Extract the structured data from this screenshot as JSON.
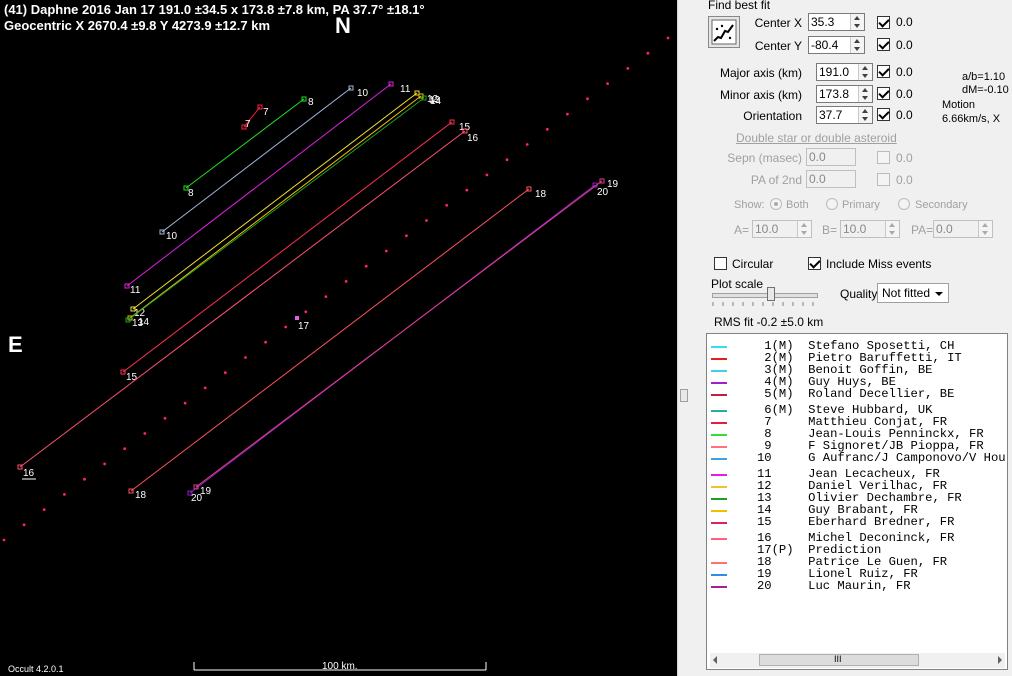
{
  "header": {
    "line1": "(41) Daphne  2016 Jan 17   191.0 ±34.5 x 173.8 ±7.8 km, PA 37.7° ±18.1°",
    "line2": "Geocentric  X  2670.4 ±9.8   Y 4273.9 ±12.7 km"
  },
  "plot": {
    "north_label": "N",
    "east_label": "E",
    "version": "Occult 4.2.0.1",
    "scale_label": "100 km.",
    "chords": [
      {
        "id": "7",
        "color": "#ff2040",
        "label_start": "7",
        "label_end": "7"
      },
      {
        "id": "8",
        "color": "#20e020",
        "label_start": "8",
        "label_end": "8"
      },
      {
        "id": "10",
        "color": "#a0b8d8",
        "label_start": "10",
        "label_end": "10"
      },
      {
        "id": "11",
        "color": "#e020e0",
        "label_start": "11",
        "label_end": "11"
      },
      {
        "id": "12",
        "color": "#f0e030",
        "label_start": "12",
        "label_end": "12"
      },
      {
        "id": "14",
        "color": "#f0c000",
        "label_start": "14",
        "label_end": "14"
      },
      {
        "id": "13",
        "color": "#20a020",
        "label_start": "13",
        "label_end": "13"
      },
      {
        "id": "15",
        "color": "#ff3050",
        "label_start": "15",
        "label_end": "15"
      },
      {
        "id": "16",
        "color": "#ff5070",
        "label_start": "16",
        "label_end": "16"
      },
      {
        "id": "18",
        "color": "#ff5060",
        "label_start": "18",
        "label_end": "18"
      },
      {
        "id": "20",
        "color": "#9020c0",
        "label_start": "20",
        "label_end": "20"
      },
      {
        "id": "19",
        "color": "#e0408a",
        "label_start": "19",
        "label_end": "19"
      }
    ],
    "prediction_label": "17"
  },
  "panel": {
    "title": "Find best fit",
    "fields": [
      {
        "label": "Center X",
        "value": "35.3",
        "checked": true,
        "result": "0.0"
      },
      {
        "label": "Center Y",
        "value": "-80.4",
        "checked": true,
        "result": "0.0"
      },
      {
        "label": "Major axis (km)",
        "value": "191.0",
        "checked": true,
        "result": "0.0"
      },
      {
        "label": "Minor axis (km)",
        "value": "173.8",
        "checked": true,
        "result": "0.0"
      },
      {
        "label": "Orientation",
        "value": "37.7",
        "checked": true,
        "result": "0.0"
      }
    ],
    "ab_ratio": "a/b=1.10",
    "dm": "dM=-0.10",
    "motion_label": "Motion",
    "motion_value": "6.66km/s, X",
    "double_header": "Double star  or  double asteroid",
    "sepn_label": "Sepn (masec)",
    "sepn_value": "0.0",
    "sepn_result": "0.0",
    "pa2_label": "PA of 2nd",
    "pa2_value": "0.0",
    "pa2_result": "0.0",
    "show_label": "Show:",
    "show_both": "Both",
    "show_primary": "Primary",
    "show_secondary": "Secondary",
    "a_label": "A=",
    "a_value": "10.0",
    "b_label": "B=",
    "b_value": "10.0",
    "pa_label": "PA=",
    "pa_value": "0.0",
    "circular_label": "Circular",
    "include_miss_label": "Include Miss events",
    "plot_scale_label": "Plot scale",
    "quality_label": "Quality",
    "quality_value": "Not fitted",
    "rms_label": "RMS fit -0.2 ±5.0 km"
  },
  "legend": [
    {
      "num": " 1",
      "flag": "(M)",
      "name": "Stefano Sposetti, CH",
      "color": "#30e0f0"
    },
    {
      "num": " 2",
      "flag": "(M)",
      "name": "Pietro Baruffetti, IT",
      "color": "#e02020"
    },
    {
      "num": " 3",
      "flag": "(M)",
      "name": "Benoit Goffin, BE",
      "color": "#40d0e0"
    },
    {
      "num": " 4",
      "flag": "(M)",
      "name": "Guy Huys, BE",
      "color": "#a020d0"
    },
    {
      "num": " 5",
      "flag": "(M)",
      "name": "Roland Decellier, BE",
      "color": "#c02040"
    },
    {
      "num": " 6",
      "flag": "(M)",
      "name": "Steve Hubbard, UK",
      "color": "#20b0a0"
    },
    {
      "num": " 7",
      "flag": "   ",
      "name": "Matthieu Conjat, FR",
      "color": "#e02040"
    },
    {
      "num": " 8",
      "flag": "   ",
      "name": "Jean-Louis Penninckx, FR",
      "color": "#30e030"
    },
    {
      "num": " 9",
      "flag": "   ",
      "name": "F Signoret/JB Pioppa, FR",
      "color": "#ff7080"
    },
    {
      "num": "10",
      "flag": "   ",
      "name": "G Aufranc/J Camponovo/V Hou",
      "color": "#40a0e0"
    },
    {
      "num": "11",
      "flag": "   ",
      "name": "Jean Lecacheux, FR",
      "color": "#e020e0"
    },
    {
      "num": "12",
      "flag": "   ",
      "name": "Daniel Verilhac, FR",
      "color": "#f0c030"
    },
    {
      "num": "13",
      "flag": "   ",
      "name": "Olivier Dechambre, FR",
      "color": "#20a020"
    },
    {
      "num": "14",
      "flag": "   ",
      "name": "Guy Brabant, FR",
      "color": "#f0c000"
    },
    {
      "num": "15",
      "flag": "   ",
      "name": "Eberhard Bredner, FR",
      "color": "#e02060"
    },
    {
      "num": "16",
      "flag": "   ",
      "name": "Michel Deconinck, FR",
      "color": "#ff6080"
    },
    {
      "num": "17",
      "flag": "(P)",
      "name": "Prediction",
      "color": "#ffffff"
    },
    {
      "num": "18",
      "flag": "   ",
      "name": "Patrice Le Guen, FR",
      "color": "#ff7070"
    },
    {
      "num": "19",
      "flag": "   ",
      "name": "Lionel Ruiz, FR",
      "color": "#3090e0"
    },
    {
      "num": "20",
      "flag": "   ",
      "name": "Luc Maurin, FR",
      "color": "#a020a0"
    }
  ],
  "legend_scroll_grip": "III"
}
